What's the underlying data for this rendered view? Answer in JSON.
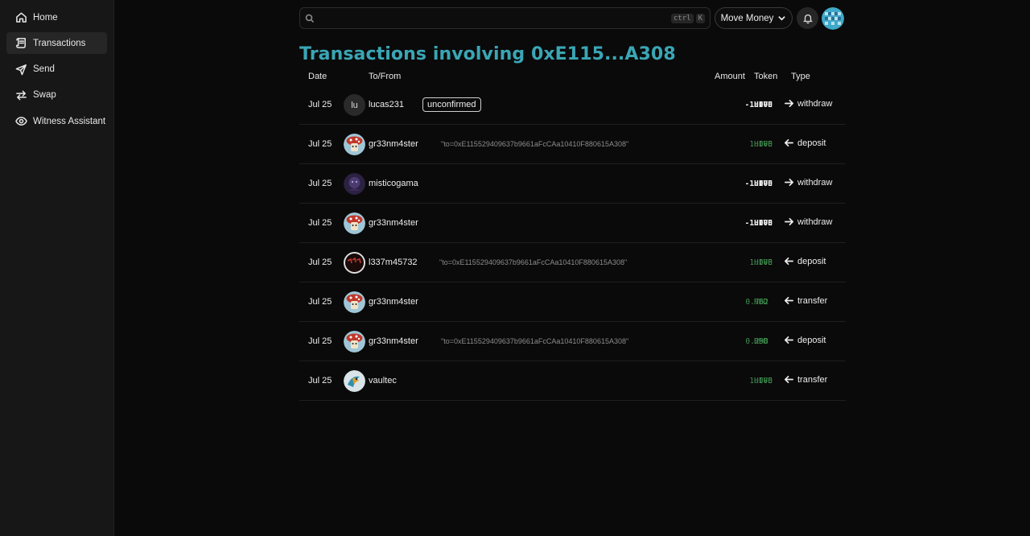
{
  "sidebar": {
    "items": [
      {
        "label": "Home",
        "icon": "home-icon",
        "active": false
      },
      {
        "label": "Transactions",
        "icon": "scroll-icon",
        "active": true
      },
      {
        "label": "Send",
        "icon": "paper-plane-icon",
        "active": false
      },
      {
        "label": "Swap",
        "icon": "swap-arrows-icon",
        "active": false
      },
      {
        "label": "Witness Assistant",
        "icon": "eye-icon",
        "active": false
      }
    ]
  },
  "header": {
    "search": {
      "value": "",
      "placeholder": "",
      "shortcut_keys": [
        "ctrl",
        "K"
      ]
    },
    "move_money_label": "Move Money",
    "notifications_icon": "bell-icon"
  },
  "page": {
    "title": "Transactions involving 0xE115...A308"
  },
  "table": {
    "headers": {
      "date": "Date",
      "to_from": "To/From",
      "amount": "Amount",
      "token": "Token",
      "type": "Type"
    },
    "rows": [
      {
        "date": "Jul 25",
        "avatar_text": "lu",
        "username": "lucas231",
        "badge": "unconfirmed",
        "memo": "",
        "amount": "-1.000",
        "token": "HIVE",
        "type": "withdraw",
        "direction": "out"
      },
      {
        "date": "Jul 25",
        "avatar_text": "",
        "username": "gr33nm4ster",
        "badge": "",
        "memo": "\"to=0xE115529409637b9661aFcCAa10410F880615A308\"",
        "amount": "1.000",
        "token": "HIVE",
        "type": "deposit",
        "direction": "in"
      },
      {
        "date": "Jul 25",
        "avatar_text": "",
        "username": "misticogama",
        "badge": "",
        "memo": "",
        "amount": "-1.000",
        "token": "HIVE",
        "type": "withdraw",
        "direction": "out"
      },
      {
        "date": "Jul 25",
        "avatar_text": "",
        "username": "gr33nm4ster",
        "badge": "",
        "memo": "",
        "amount": "-1.000",
        "token": "HIVE",
        "type": "withdraw",
        "direction": "out"
      },
      {
        "date": "Jul 25",
        "avatar_text": "",
        "username": "l337m45732",
        "badge": "",
        "memo": "\"to=0xE115529409637b9661aFcCAa10410F880615A308\"",
        "amount": "1.000",
        "token": "HIVE",
        "type": "deposit",
        "direction": "in"
      },
      {
        "date": "Jul 25",
        "avatar_text": "",
        "username": "gr33nm4ster",
        "badge": "",
        "memo": "",
        "amount": "0.762",
        "token": "HBD",
        "type": "transfer",
        "direction": "in"
      },
      {
        "date": "Jul 25",
        "avatar_text": "",
        "username": "gr33nm4ster",
        "badge": "",
        "memo": "\"to=0xE115529409637b9661aFcCAa10410F880615A308\"",
        "amount": "0.298",
        "token": "HBD",
        "type": "deposit",
        "direction": "in"
      },
      {
        "date": "Jul 25",
        "avatar_text": "",
        "username": "vaultec",
        "badge": "",
        "memo": "",
        "amount": "1.000",
        "token": "HIVE",
        "type": "transfer",
        "direction": "in"
      }
    ]
  },
  "colors": {
    "title_accent": "#3aa6b5",
    "positive_amount": "#3f8f4f",
    "background": "#0a0a0a",
    "sidebar_bg": "#171717"
  }
}
